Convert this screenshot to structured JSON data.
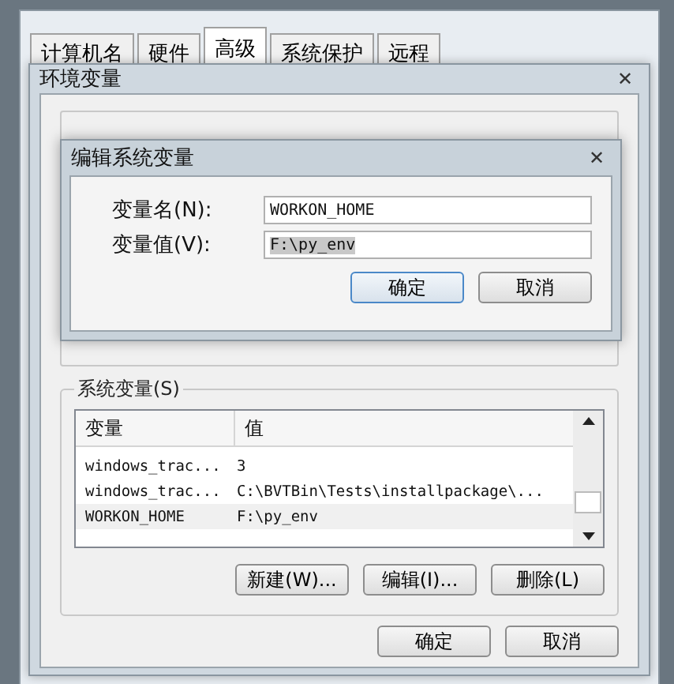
{
  "tabs": [
    {
      "label": "计算机名",
      "selected": false
    },
    {
      "label": "硬件",
      "selected": false
    },
    {
      "label": "高级",
      "selected": true
    },
    {
      "label": "系统保护",
      "selected": false
    },
    {
      "label": "远程",
      "selected": false
    }
  ],
  "env_window": {
    "title": "环境变量",
    "close": "✕"
  },
  "edit_dialog": {
    "title": "编辑系统变量",
    "close": "✕",
    "fields": [
      {
        "label": "变量名(N):",
        "value": "WORKON_HOME",
        "highlighted": false
      },
      {
        "label": "变量值(V):",
        "value": "F:\\py_env",
        "highlighted": true
      }
    ],
    "buttons": [
      "确定",
      "取消"
    ]
  },
  "system_vars": {
    "title": "系统变量(S)",
    "columns": [
      "变量",
      "值"
    ],
    "rows": [
      {
        "name": "windows_trac...",
        "value": "3",
        "selected": false
      },
      {
        "name": "windows_trac...",
        "value": "C:\\BVTBin\\Tests\\installpackage\\...",
        "selected": false
      },
      {
        "name": "WORKON_HOME",
        "value": "F:\\py_env",
        "selected": true
      }
    ],
    "buttons": [
      "新建(W)...",
      "编辑(I)...",
      "删除(L)"
    ]
  },
  "buttons": [
    "确定",
    "取消"
  ]
}
